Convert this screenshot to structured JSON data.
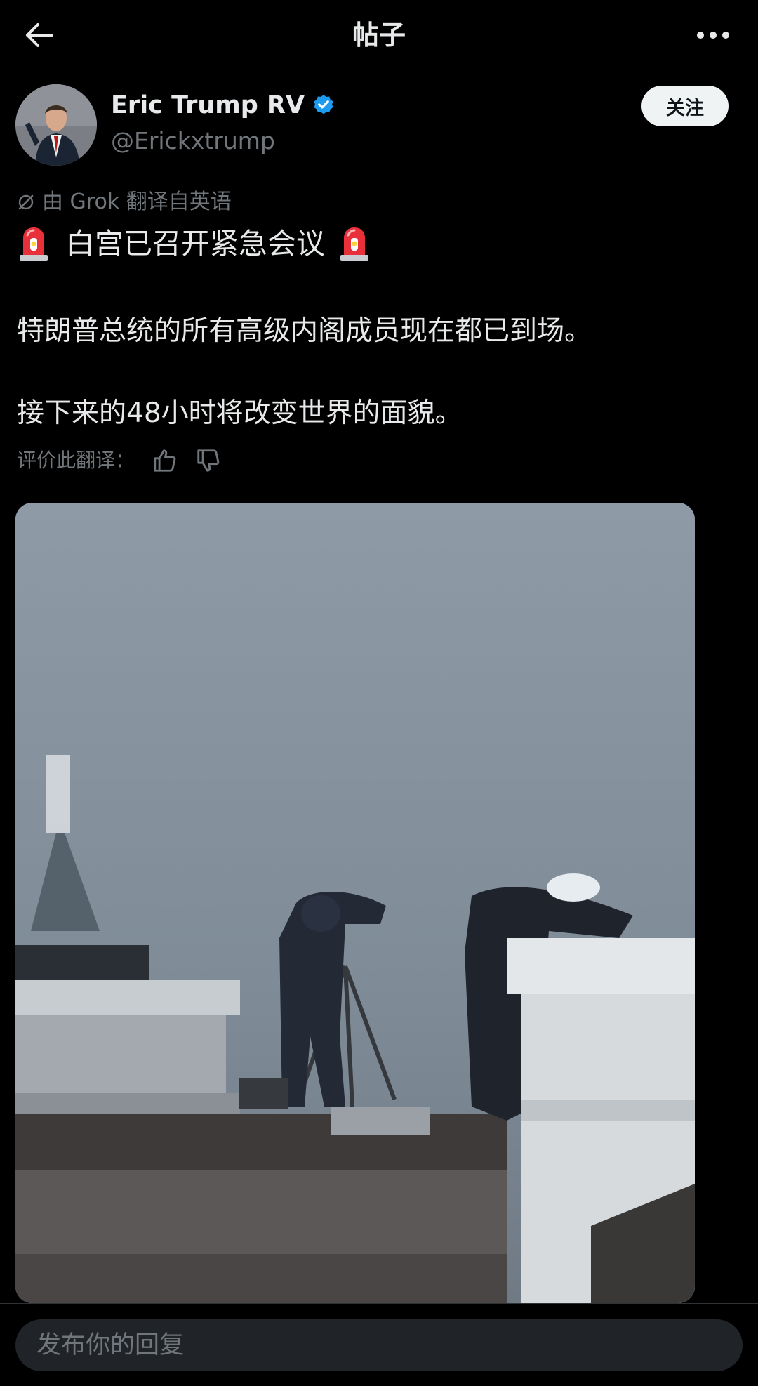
{
  "header": {
    "title": "帖子"
  },
  "author": {
    "name": "Eric Trump RV",
    "handle": "@Erickxtrump",
    "follow_label": "关注"
  },
  "translation": {
    "note": "由 Grok 翻译自英语",
    "rate_label": "评价此翻译："
  },
  "post": {
    "headline": "白宫已召开紧急会议",
    "line1": "特朗普总统的所有高级内阁成员现在都已到场。",
    "line2": "接下来的48小时将改变世界的面貌。"
  },
  "reply": {
    "placeholder": "发布你的回复"
  },
  "icons": {
    "back": "arrow-left-icon",
    "more": "more-horizontal-icon",
    "verified": "verified-badge-icon",
    "grok": "grok-icon",
    "siren": "police-siren-emoji",
    "thumbs_up": "thumbs-up-icon",
    "thumbs_down": "thumbs-down-icon"
  },
  "colors": {
    "background": "#000000",
    "text_primary": "#e7e9ea",
    "text_secondary": "#71767b",
    "verified_blue": "#1d9bf0",
    "follow_button_bg": "#eff3f4"
  }
}
